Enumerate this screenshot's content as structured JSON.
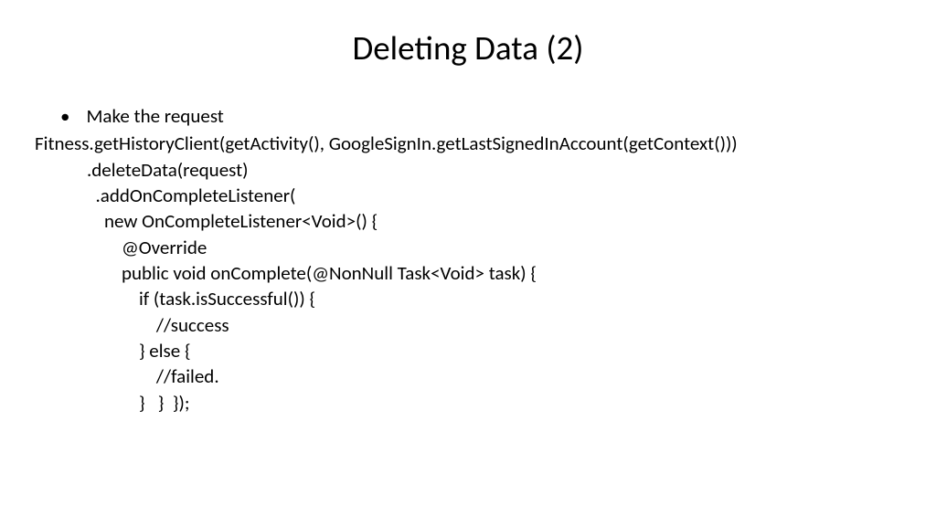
{
  "slide": {
    "title": "Deleting Data (2)",
    "bullet": "Make the request",
    "code": {
      "line1": "Fitness.getHistoryClient(getActivity(), GoogleSignIn.getLastSignedInAccount(getContext()))",
      "line2": "            .deleteData(request)",
      "line3": "              .addOnCompleteListener(",
      "line4": "                new OnCompleteListener<Void>() {",
      "line5": "                    @Override",
      "line6": "                    public void onComplete(@NonNull Task<Void> task) {",
      "line7": "                        if (task.isSuccessful()) {",
      "line8": "                            //success",
      "line9": "                        } else {",
      "line10": "                            //failed.",
      "line11": "                        }   }  });"
    }
  }
}
